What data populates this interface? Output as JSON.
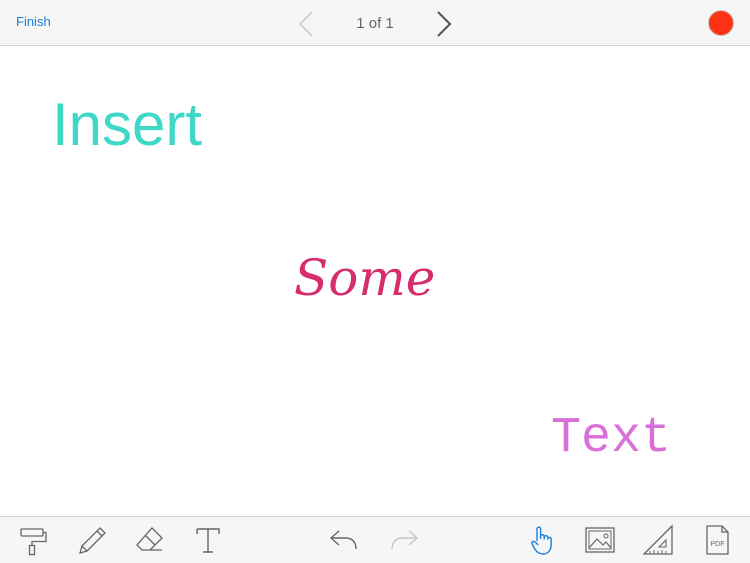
{
  "header": {
    "finish_label": "Finish",
    "page_indicator": "1 of 1",
    "record_color": "#ff3214"
  },
  "canvas": {
    "texts": [
      {
        "text": "Insert",
        "color": "#3fd8c6"
      },
      {
        "text": "Some",
        "color": "#d52d6e"
      },
      {
        "text": "Text",
        "color": "#d870d8"
      }
    ]
  },
  "toolbar": {
    "tools": [
      "paint-roller-icon",
      "pen-icon",
      "eraser-icon",
      "text-tool-icon",
      "undo-icon",
      "redo-icon",
      "hand-pointer-icon",
      "image-icon",
      "ruler-triangle-icon",
      "pdf-icon"
    ],
    "active_tool": "hand-pointer-icon",
    "active_color": "#1a7fd9"
  }
}
